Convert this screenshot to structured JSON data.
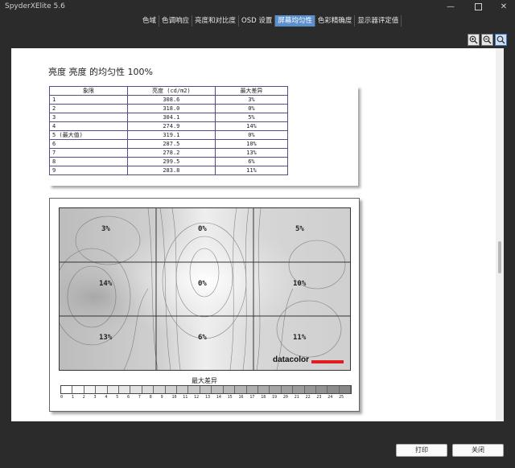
{
  "window": {
    "title": "SpyderXElite 5.6",
    "minimize": "—",
    "close": "✕"
  },
  "tabs": [
    {
      "label": "色域",
      "active": false
    },
    {
      "label": "色调响应",
      "active": false
    },
    {
      "label": "亮度和对比度",
      "active": false
    },
    {
      "label": "OSD 设置",
      "active": false
    },
    {
      "label": "屏幕均匀性",
      "active": true
    },
    {
      "label": "色彩精确度",
      "active": false
    },
    {
      "label": "显示器评定值",
      "active": false
    }
  ],
  "zoom_icons": [
    "zoom-in-icon",
    "zoom-out-icon",
    "zoom-fit-icon"
  ],
  "report": {
    "title": "亮度 亮度 的均匀性 100%",
    "table": {
      "headers": [
        "象限",
        "亮度 (cd/m2)",
        "最大差异"
      ],
      "rows": [
        [
          "1",
          "308.6",
          "3%"
        ],
        [
          "2",
          "318.0",
          "0%"
        ],
        [
          "3",
          "304.1",
          "5%"
        ],
        [
          "4",
          "274.9",
          "14%"
        ],
        [
          "5 (最大值)",
          "319.1",
          "0%"
        ],
        [
          "6",
          "287.5",
          "10%"
        ],
        [
          "7",
          "278.2",
          "13%"
        ],
        [
          "8",
          "299.5",
          "6%"
        ],
        [
          "9",
          "283.8",
          "11%"
        ]
      ]
    },
    "contour": {
      "cells": [
        "3%",
        "0%",
        "5%",
        "14%",
        "0%",
        "10%",
        "13%",
        "6%",
        "11%"
      ],
      "logo": "datacolor",
      "logo_color": "#e11b22",
      "legend_title": "最大差异",
      "legend_ticks": [
        "0",
        "1",
        "2",
        "3",
        "4",
        "5",
        "6",
        "7",
        "8",
        "9",
        "10",
        "11",
        "12",
        "13",
        "14",
        "15",
        "16",
        "17",
        "18",
        "19",
        "20",
        "21",
        "22",
        "23",
        "24",
        "25"
      ]
    }
  },
  "buttons": {
    "print": "打印",
    "close": "关闭"
  },
  "colors": {
    "active_tab": "#5a8fd0",
    "table_border": "#5b4a86"
  }
}
